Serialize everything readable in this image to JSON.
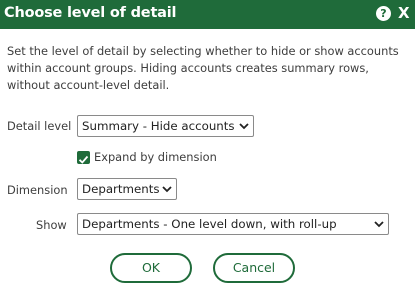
{
  "dialog": {
    "title": "Choose level of detail",
    "help_glyph": "?",
    "close_glyph": "X",
    "description": "Set the level of detail by selecting whether to hide or show accounts within account groups. Hiding accounts creates summary rows, without account-level detail."
  },
  "form": {
    "detail_level": {
      "label": "Detail level",
      "value": "Summary - Hide accounts"
    },
    "expand": {
      "label": "Expand by dimension",
      "checked": true
    },
    "dimension": {
      "label": "Dimension",
      "value": "Departments"
    },
    "show": {
      "label": "Show",
      "value": "Departments - One level down, with roll-up"
    }
  },
  "buttons": {
    "ok": "OK",
    "cancel": "Cancel"
  },
  "colors": {
    "brand": "#1f6b3a",
    "text": "#3d3d3d"
  },
  "icons": {
    "help": "question-circle-icon",
    "close": "close-icon",
    "chevron": "chevron-down-icon",
    "check": "checkmark-icon"
  }
}
